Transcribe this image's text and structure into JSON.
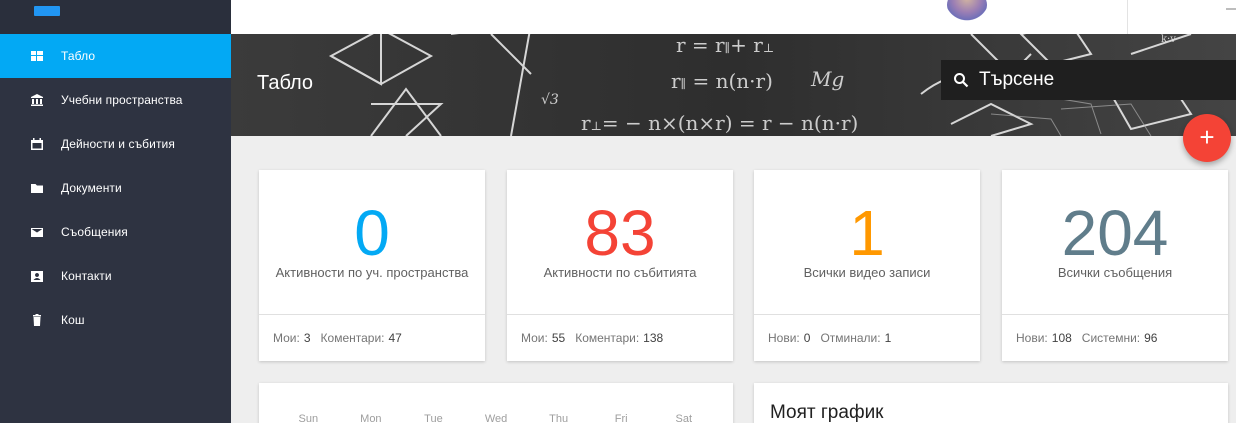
{
  "sidebar": {
    "items": [
      {
        "label": "Табло",
        "icon": "dashboard-icon",
        "active": true
      },
      {
        "label": "Учебни пространства",
        "icon": "classroom-icon"
      },
      {
        "label": "Дейности и събития",
        "icon": "calendar-icon"
      },
      {
        "label": "Документи",
        "icon": "folder-icon"
      },
      {
        "label": "Съобщения",
        "icon": "mail-icon"
      },
      {
        "label": "Контакти",
        "icon": "contact-icon"
      },
      {
        "label": "Кош",
        "icon": "trash-icon"
      }
    ]
  },
  "header": {
    "page_title": "Табло",
    "search_placeholder": "Търсене",
    "fab_label": "+"
  },
  "stats": [
    {
      "value": "0",
      "caption": "Активности по уч. пространства",
      "color": "#03a9f4",
      "foot": [
        {
          "label": "Мои:",
          "value": "3"
        },
        {
          "label": "Коментари:",
          "value": "47"
        }
      ]
    },
    {
      "value": "83",
      "caption": "Активности по събитията",
      "color": "#f44336",
      "foot": [
        {
          "label": "Мои:",
          "value": "55"
        },
        {
          "label": "Коментари:",
          "value": "138"
        }
      ]
    },
    {
      "value": "1",
      "caption": "Всички видео записи",
      "color": "#ff9800",
      "foot": [
        {
          "label": "Нови:",
          "value": "0"
        },
        {
          "label": "Отминали:",
          "value": "1"
        }
      ]
    },
    {
      "value": "204",
      "caption": "Всички съобщения",
      "color": "#607d8b",
      "foot": [
        {
          "label": "Нови:",
          "value": "108"
        },
        {
          "label": "Системни:",
          "value": "96"
        }
      ]
    }
  ],
  "calendar": {
    "weekdays": [
      "Sun",
      "Mon",
      "Tue",
      "Wed",
      "Thu",
      "Fri",
      "Sat"
    ]
  },
  "schedule": {
    "title": "Моят график"
  },
  "colors": {
    "sidebar_bg": "#2e3341",
    "active_item": "#03a9f4",
    "fab": "#f44336"
  }
}
